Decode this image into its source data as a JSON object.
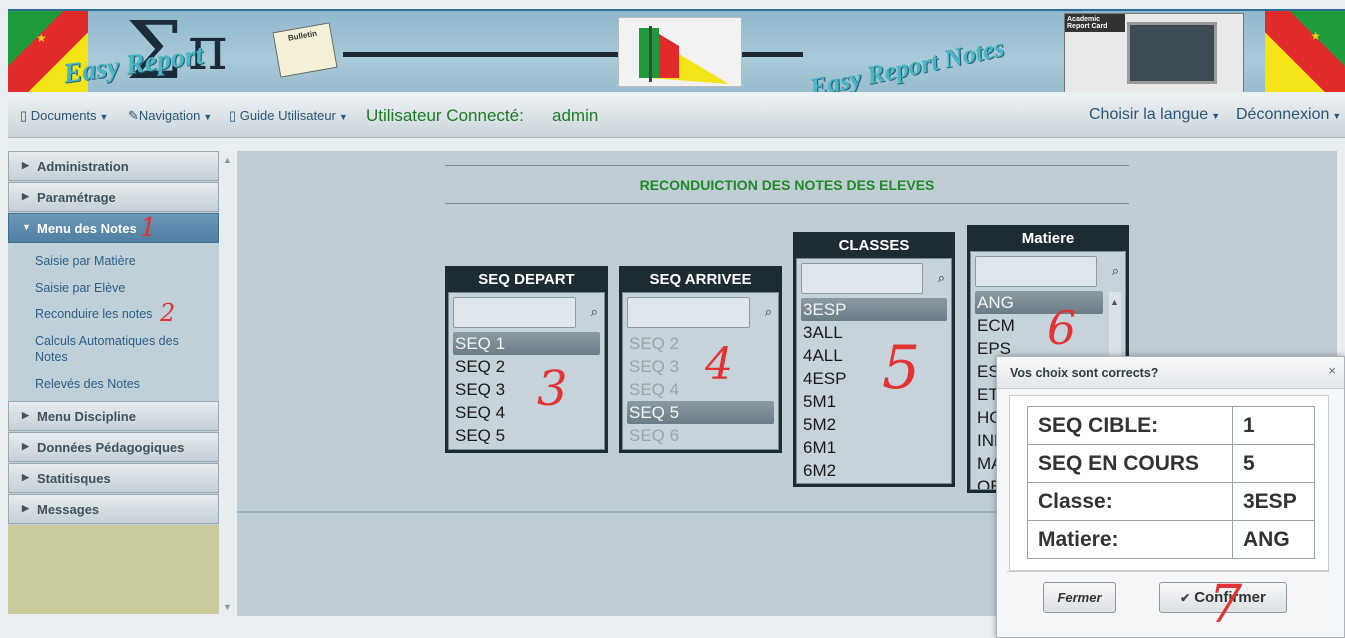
{
  "nav": {
    "documents": "Documents",
    "navigation": "Navigation",
    "guide": "Guide Utilisateur",
    "user_label": "Utilisateur Connecté:",
    "user_name": "admin",
    "language": "Choisir la langue",
    "logout": "Déconnexion"
  },
  "banner": {
    "logo_left": "Easy Report",
    "logo_right": "Easy Report Notes",
    "bulletin": "Bulletin",
    "report_card": "Academic Report Card"
  },
  "sidebar": {
    "administration": "Administration",
    "parametrage": "Paramétrage",
    "menu_notes": "Menu des Notes",
    "saisie_matiere": "Saisie par Matière",
    "saisie_eleve": "Saisie par Elève",
    "reconduire": "Reconduire les notes",
    "calculs": "Calculs Automatiques des Notes",
    "releves": "Relevés des Notes",
    "discipline": "Menu Discipline",
    "pedagogiques": "Données Pédagogiques",
    "statistiques": "Statitisques",
    "messages": "Messages"
  },
  "page": {
    "title": "RECONDUICTION DES NOTES DES ELEVES"
  },
  "lists": {
    "seq_depart": {
      "title": "SEQ DEPART",
      "items": [
        "SEQ 1",
        "SEQ 2",
        "SEQ 3",
        "SEQ 4",
        "SEQ 5"
      ]
    },
    "seq_arrivee": {
      "title": "SEQ ARRIVEE",
      "items": [
        "SEQ 2",
        "SEQ 3",
        "SEQ 4",
        "SEQ 5",
        "SEQ 6"
      ]
    },
    "classes": {
      "title": "CLASSES",
      "items": [
        "3ESP",
        "3ALL",
        "4ALL",
        "4ESP",
        "5M1",
        "5M2",
        "6M1",
        "6M2"
      ]
    },
    "matiere": {
      "title": "Matiere",
      "items": [
        "ANG",
        "ECM",
        "EPS",
        "ESP",
        "ETN",
        "HG",
        "INFO",
        "MAT",
        "OB"
      ]
    }
  },
  "annotations": [
    "1",
    "2",
    "3",
    "4",
    "5",
    "6",
    "7"
  ],
  "dialog": {
    "title": "Vos choix sont corrects?",
    "close": "×",
    "rows": [
      {
        "key": "SEQ CIBLE:",
        "value": "1"
      },
      {
        "key": "SEQ EN COURS",
        "value": "5"
      },
      {
        "key": "Classe:",
        "value": "3ESP"
      },
      {
        "key": "Matiere:",
        "value": "ANG"
      }
    ],
    "close_button": "Fermer",
    "confirm_button": "Confirmer"
  },
  "colors": {
    "accent_green": "#1e8a26",
    "link_blue": "#2f5e85",
    "annotation_red": "#e23232"
  },
  "icons": {
    "search": "search-icon",
    "check": "check-icon",
    "caret": "caret-down-icon"
  }
}
